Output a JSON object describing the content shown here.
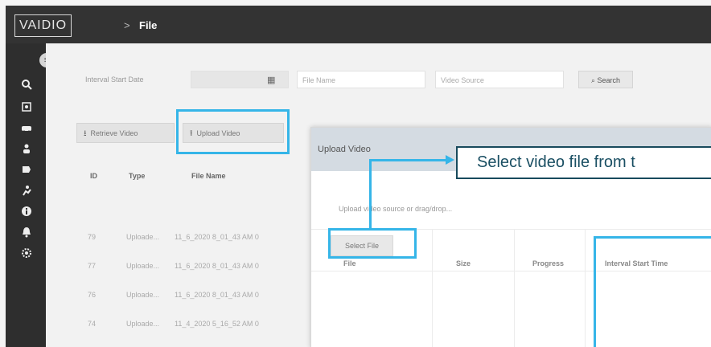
{
  "app": {
    "logo_text": "VAIDIO",
    "breadcrumb_sep": ">",
    "breadcrumb_current": "File"
  },
  "sidebar": {
    "toggle_icon": "menu-toggle-icon",
    "icons": [
      "search-icon",
      "face-icon",
      "vehicle-icon",
      "person-icon",
      "object-icon",
      "activity-icon",
      "info-icon",
      "alert-icon",
      "settings-icon"
    ]
  },
  "filters": {
    "interval_start_label": "Interval Start Date",
    "interval_start_value": "",
    "file_name_placeholder": "File Name",
    "video_source_placeholder": "Video Source",
    "search_label": "Search"
  },
  "toolbar": {
    "retrieve_label": "Retrieve Video",
    "upload_label": "Upload Video"
  },
  "table": {
    "columns": [
      "ID",
      "Type",
      "File Name"
    ],
    "rows": [
      {
        "id": "79",
        "type": "Uploade...",
        "file_name": "11_6_2020 8_01_43 AM 0"
      },
      {
        "id": "77",
        "type": "Uploade...",
        "file_name": "11_6_2020 8_01_43 AM 0"
      },
      {
        "id": "76",
        "type": "Uploade...",
        "file_name": "11_6_2020 8_01_43 AM 0"
      },
      {
        "id": "74",
        "type": "Uploade...",
        "file_name": "11_4_2020 5_16_52 AM 0"
      }
    ]
  },
  "modal": {
    "title": "Upload Video",
    "hint": "Upload video source or drag/drop...",
    "select_file_label": "Select File",
    "columns": [
      "File",
      "Size",
      "Progress",
      "Interval Start Time"
    ]
  },
  "callout": {
    "text": "Select video file from t"
  },
  "colors": {
    "highlight": "#35b5e8",
    "callout_border": "#184a5c",
    "topbar": "#333333",
    "sidebar": "#2e2e2e",
    "modal_header": "#d4dbe2"
  }
}
